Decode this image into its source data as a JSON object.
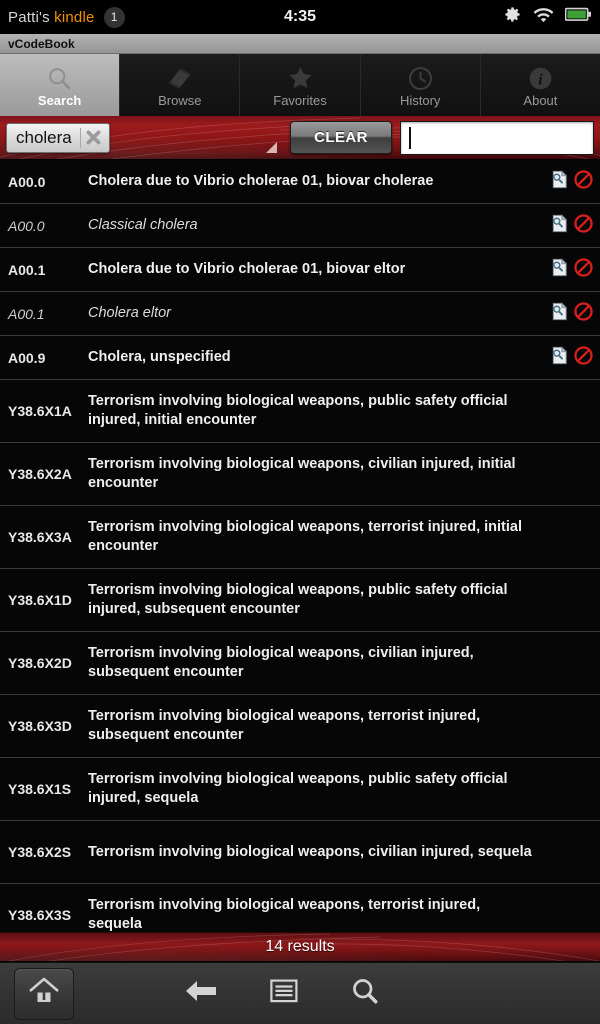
{
  "statusbar": {
    "device_name_prefix": "Patti's ",
    "device_name_brand": "kindle",
    "notification_count": "1",
    "clock": "4:35",
    "icons": [
      "gear-icon",
      "wifi-icon",
      "battery-icon"
    ],
    "battery_color": "#3ea037"
  },
  "titlebar": {
    "app_title": "vCodeBook"
  },
  "tabs": [
    {
      "label": "Search",
      "icon": "magnifier-icon",
      "active": true
    },
    {
      "label": "Browse",
      "icon": "book-icon",
      "active": false
    },
    {
      "label": "Favorites",
      "icon": "star-icon",
      "active": false
    },
    {
      "label": "History",
      "icon": "clock-icon",
      "active": false
    },
    {
      "label": "About",
      "icon": "info-icon",
      "active": false
    }
  ],
  "search": {
    "chip_label": "cholera",
    "chip_remove_icon": "close-x-icon",
    "dropdown_icon": "dropdown-triangle-icon",
    "clear_label": "CLEAR",
    "input_value": "",
    "input_placeholder": ""
  },
  "results": {
    "footer_text": "14 results",
    "row_action_icons": [
      "document-search-icon",
      "exclude-icon"
    ],
    "rows": [
      {
        "code": "A00.0",
        "desc": "Cholera due to Vibrio cholerae 01, biovar cholerae",
        "style": "main",
        "lines": 1,
        "has_actions": true
      },
      {
        "code": "A00.0",
        "desc": "Classical cholera",
        "style": "sub",
        "lines": 1,
        "has_actions": true
      },
      {
        "code": "A00.1",
        "desc": "Cholera due to Vibrio cholerae 01, biovar eltor",
        "style": "main",
        "lines": 1,
        "has_actions": true
      },
      {
        "code": "A00.1",
        "desc": "Cholera eltor",
        "style": "sub",
        "lines": 1,
        "has_actions": true
      },
      {
        "code": "A00.9",
        "desc": "Cholera, unspecified",
        "style": "main",
        "lines": 1,
        "has_actions": true
      },
      {
        "code": "Y38.6X1A",
        "desc": "Terrorism involving biological weapons, public safety official injured, initial encounter",
        "style": "main",
        "lines": 2,
        "has_actions": false
      },
      {
        "code": "Y38.6X2A",
        "desc": "Terrorism involving biological weapons, civilian injured, initial encounter",
        "style": "main",
        "lines": 2,
        "has_actions": false
      },
      {
        "code": "Y38.6X3A",
        "desc": "Terrorism involving biological weapons, terrorist injured, initial encounter",
        "style": "main",
        "lines": 2,
        "has_actions": false
      },
      {
        "code": "Y38.6X1D",
        "desc": "Terrorism involving biological weapons, public safety official injured, subsequent encounter",
        "style": "main",
        "lines": 2,
        "has_actions": false
      },
      {
        "code": "Y38.6X2D",
        "desc": "Terrorism involving biological weapons, civilian injured, subsequent encounter",
        "style": "main",
        "lines": 2,
        "has_actions": false
      },
      {
        "code": "Y38.6X3D",
        "desc": "Terrorism involving biological weapons, terrorist injured, subsequent encounter",
        "style": "main",
        "lines": 2,
        "has_actions": false
      },
      {
        "code": "Y38.6X1S",
        "desc": "Terrorism involving biological weapons, public safety official injured, sequela",
        "style": "main",
        "lines": 2,
        "has_actions": false
      },
      {
        "code": "Y38.6X2S",
        "desc": "Terrorism involving biological weapons, civilian injured, sequela",
        "style": "main",
        "lines": 2,
        "has_actions": false
      },
      {
        "code": "Y38.6X3S",
        "desc": "Terrorism involving biological weapons, terrorist injured, sequela",
        "style": "main",
        "lines": 2,
        "has_actions": false
      }
    ]
  },
  "navbar": {
    "items": [
      {
        "icon": "home-icon"
      },
      {
        "icon": "back-arrow-icon"
      },
      {
        "icon": "menu-icon"
      },
      {
        "icon": "search-icon"
      }
    ]
  },
  "theme": {
    "accent_red": "#8e181b",
    "brand_orange": "#f29000",
    "tab_active_bg": "#b0b0b0"
  }
}
